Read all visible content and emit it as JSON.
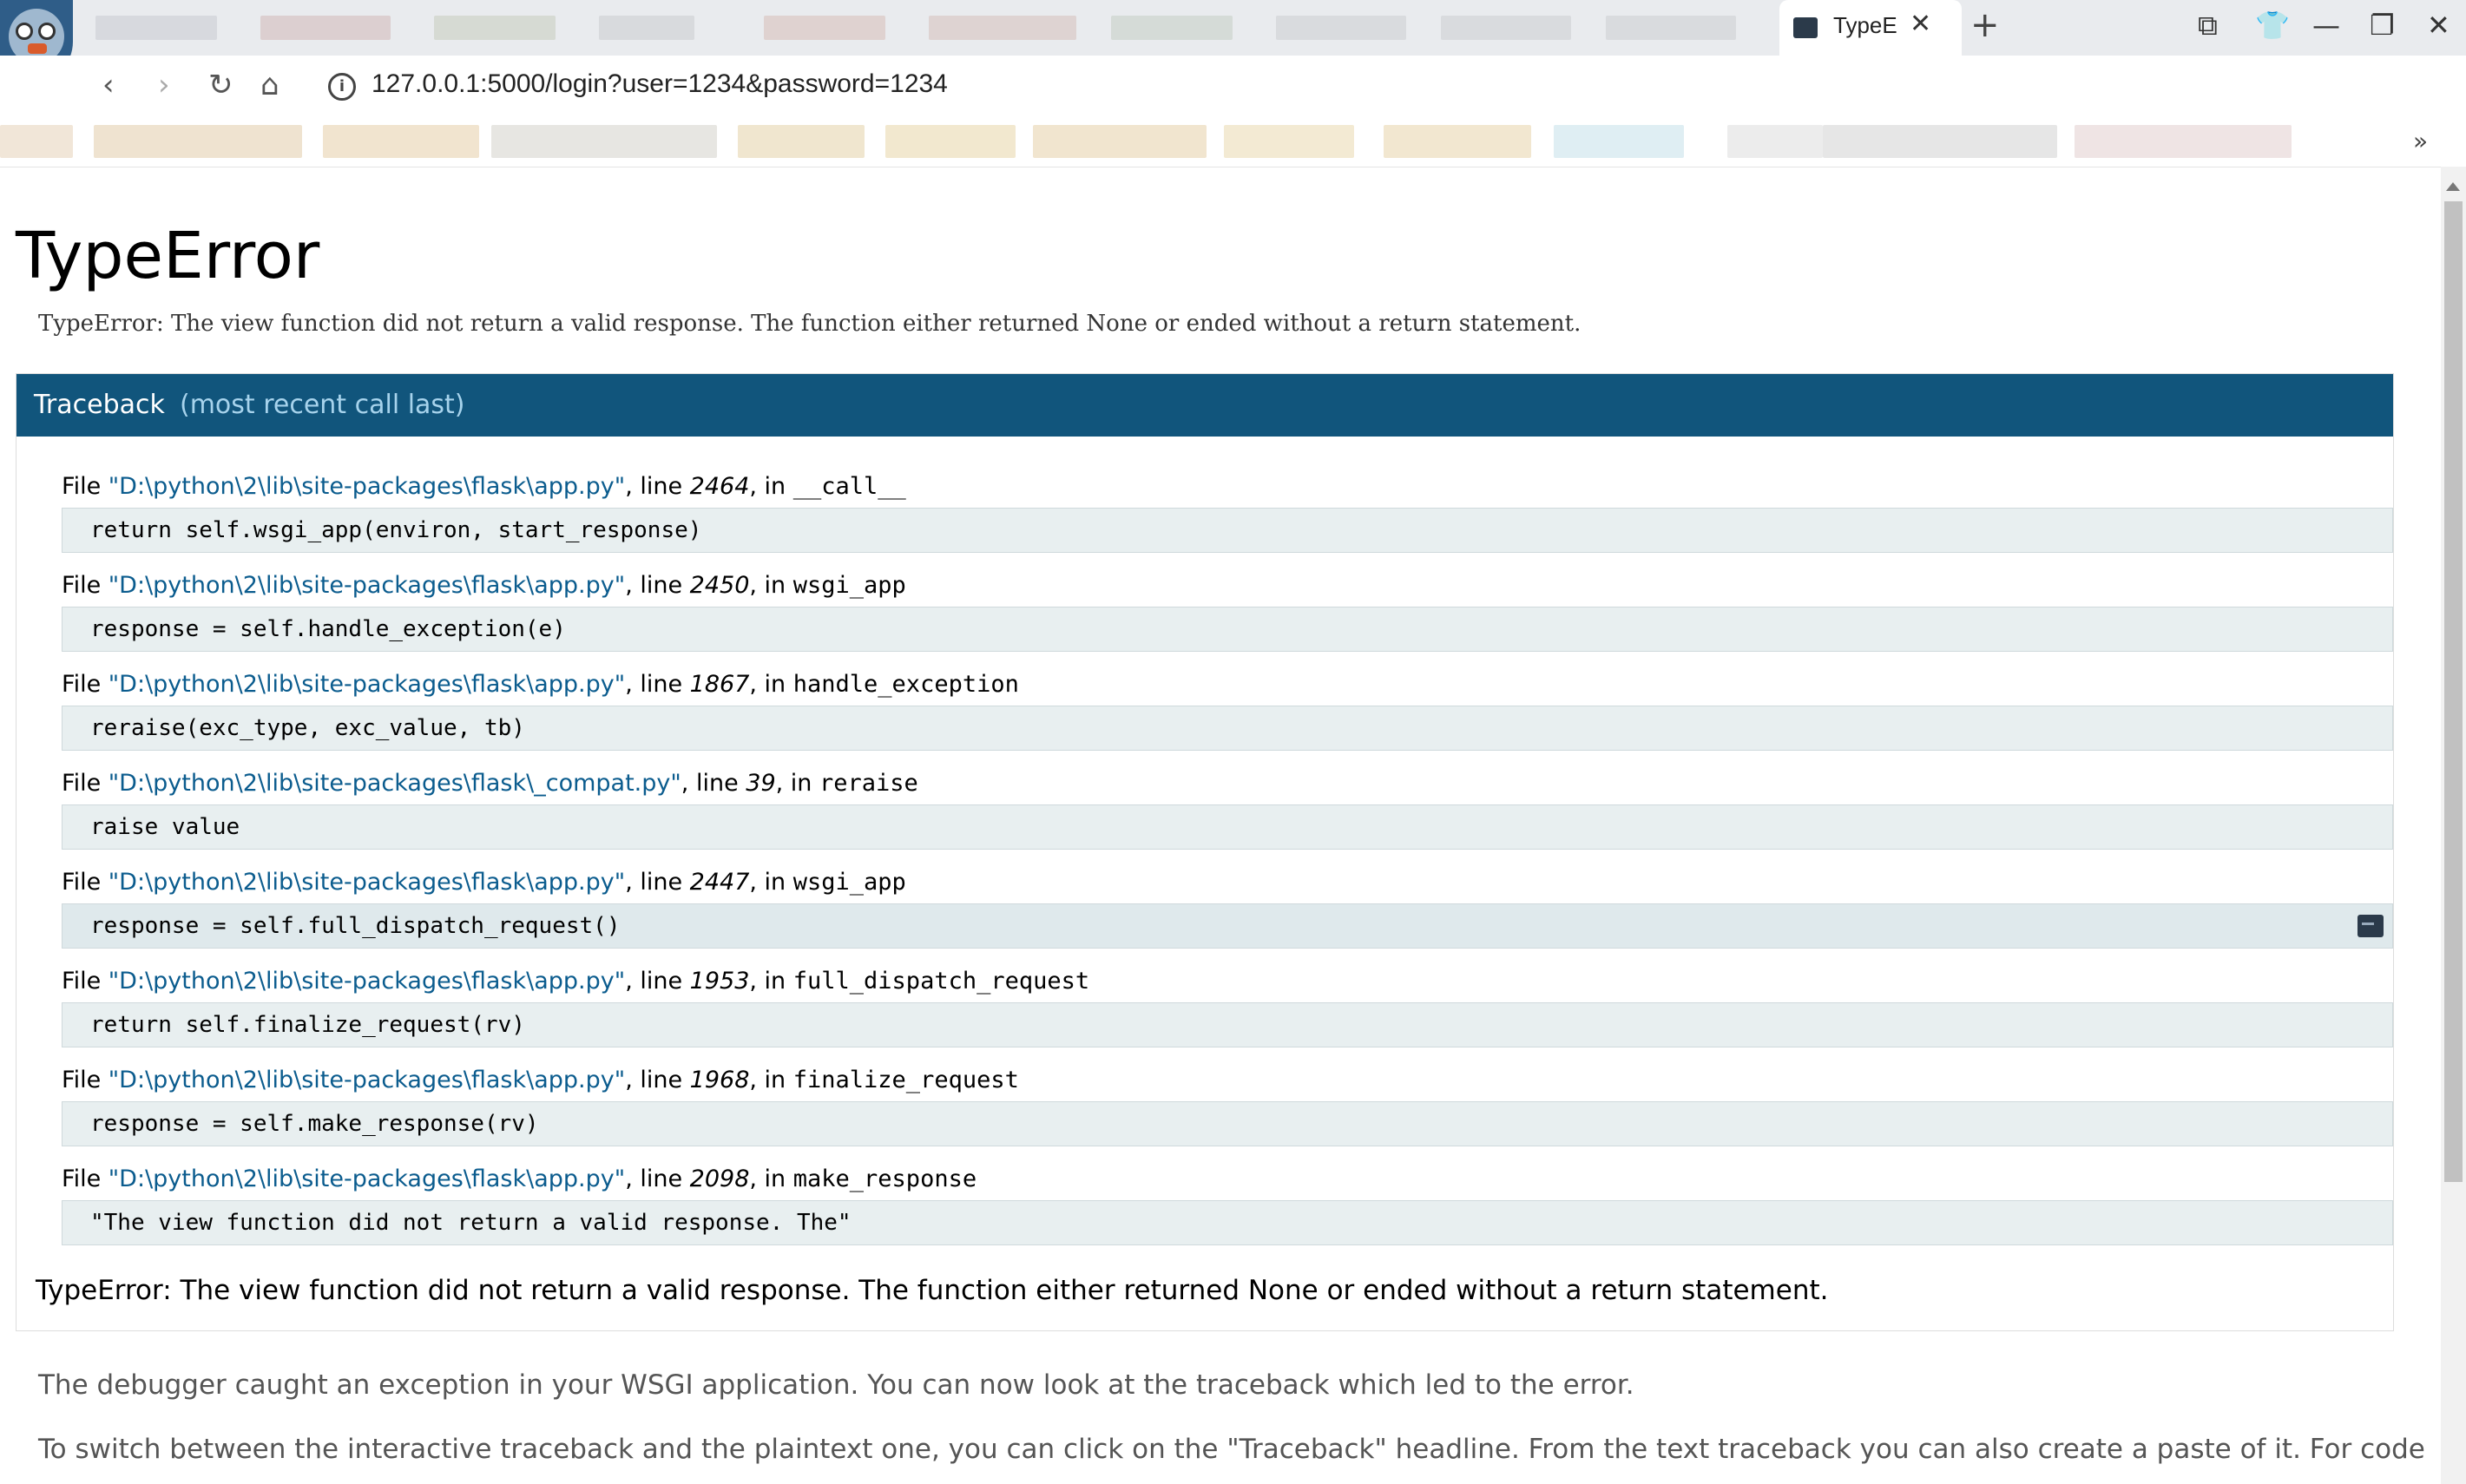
{
  "browser": {
    "active_tab_title": "TypeE",
    "url": "127.0.0.1:5000/login?user=1234&password=1234",
    "bookmark_overflow": "»"
  },
  "page": {
    "title": "TypeError",
    "error_message": "TypeError: The view function did not return a valid response. The function either returned None or ended without a return statement.",
    "traceback": {
      "header": "Traceback",
      "header_note": "(most recent call last)",
      "frames": [
        {
          "file": "\"D:\\python\\2\\lib\\site-packages\\flask\\app.py\"",
          "line": "2464",
          "function": "__call__",
          "code": "return self.wsgi_app(environ, start_response)"
        },
        {
          "file": "\"D:\\python\\2\\lib\\site-packages\\flask\\app.py\"",
          "line": "2450",
          "function": "wsgi_app",
          "code": "response = self.handle_exception(e)"
        },
        {
          "file": "\"D:\\python\\2\\lib\\site-packages\\flask\\app.py\"",
          "line": "1867",
          "function": "handle_exception",
          "code": "reraise(exc_type, exc_value, tb)"
        },
        {
          "file": "\"D:\\python\\2\\lib\\site-packages\\flask\\_compat.py\"",
          "line": "39",
          "function": "reraise",
          "code": "raise value"
        },
        {
          "file": "\"D:\\python\\2\\lib\\site-packages\\flask\\app.py\"",
          "line": "2447",
          "function": "wsgi_app",
          "code": "response = self.full_dispatch_request()"
        },
        {
          "file": "\"D:\\python\\2\\lib\\site-packages\\flask\\app.py\"",
          "line": "1953",
          "function": "full_dispatch_request",
          "code": "return self.finalize_request(rv)"
        },
        {
          "file": "\"D:\\python\\2\\lib\\site-packages\\flask\\app.py\"",
          "line": "1968",
          "function": "finalize_request",
          "code": "response = self.make_response(rv)"
        },
        {
          "file": "\"D:\\python\\2\\lib\\site-packages\\flask\\app.py\"",
          "line": "2098",
          "function": "make_response",
          "code": "\"The view function did not return a valid response. The\""
        }
      ],
      "final_error": "TypeError: The view function did not return a valid response. The function either returned None or ended without a return statement."
    },
    "footer": {
      "p1": "The debugger caught an exception in your WSGI application. You can now look at the traceback which led to the error.",
      "p2": "To switch between the interactive traceback and the plaintext one, you can click on the \"Traceback\" headline. From the text traceback you can also create a paste of it. For code"
    }
  },
  "labels": {
    "file_word": "File ",
    "line_word": ", line ",
    "in_word": ", in "
  },
  "colors": {
    "header_bg": "#11557c",
    "header_note": "#a7d3ec",
    "filename": "#0b5c8e",
    "code_bg": "#e8eff0"
  }
}
